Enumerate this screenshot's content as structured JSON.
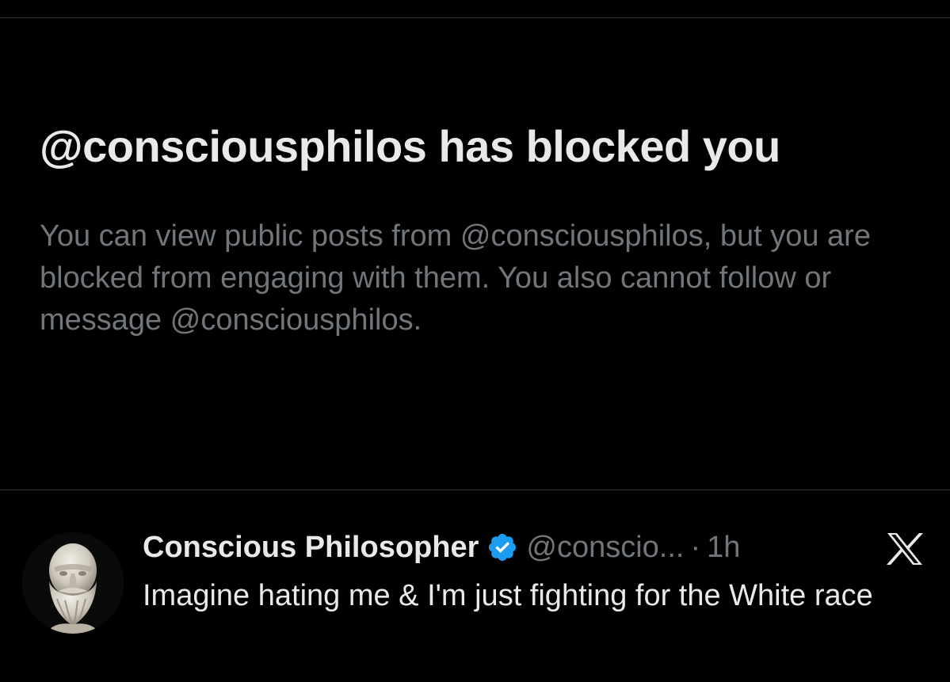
{
  "blocked_notice": {
    "title": "@consciousphilos has blocked you",
    "description": "You can view public posts from @consciousphilos, but you are blocked from engaging with them. You also cannot follow or message @consciousphilos."
  },
  "post": {
    "author_name": "Conscious Philosopher",
    "verified_icon": "verified-badge-icon",
    "handle": "@conscio...",
    "separator": "·",
    "time": "1h",
    "text": "Imagine hating me & I'm just fighting for the White race",
    "platform_icon": "x-logo-icon"
  },
  "colors": {
    "background": "#000000",
    "primary_text": "#e7e9ea",
    "secondary_text": "#71767b",
    "divider": "#2f3336",
    "verified_blue": "#1d9bf0"
  }
}
